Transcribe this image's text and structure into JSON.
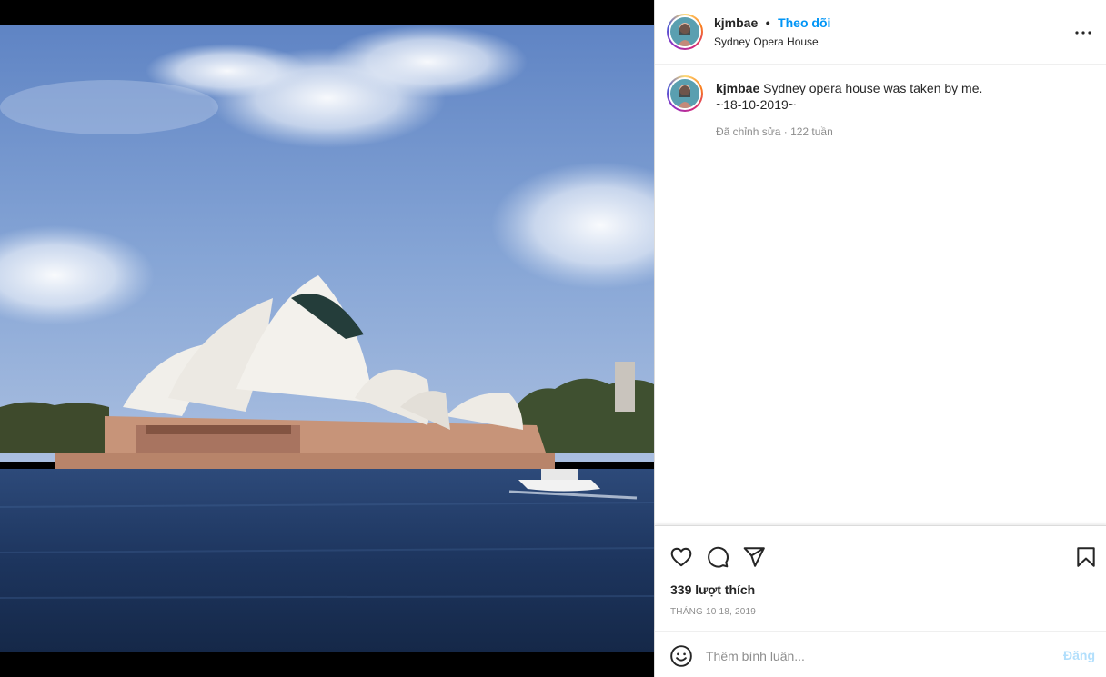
{
  "post": {
    "username": "kjmbae",
    "separator": "•",
    "follow_label": "Theo dõi",
    "location": "Sydney Opera House"
  },
  "caption": {
    "username": "kjmbae",
    "text": "Sydney opera house was taken by me.",
    "date_line": "~18-10-2019~",
    "meta": "Đã chỉnh sửa · 122 tuần"
  },
  "engagement": {
    "likes": "339 lượt thích",
    "date": "THÁNG 10 18, 2019"
  },
  "comment_bar": {
    "placeholder": "Thêm bình luận...",
    "post_label": "Đăng"
  },
  "icons": {
    "more": "more-horizontal-icon",
    "like": "heart-icon",
    "comment": "comment-bubble-icon",
    "share": "paper-plane-icon",
    "save": "bookmark-icon",
    "emoji": "smiley-icon"
  },
  "colors": {
    "link_blue": "#0095f6",
    "post_disabled": "#b2dffc",
    "muted_text": "#8e8e8e",
    "primary_text": "#262626"
  }
}
